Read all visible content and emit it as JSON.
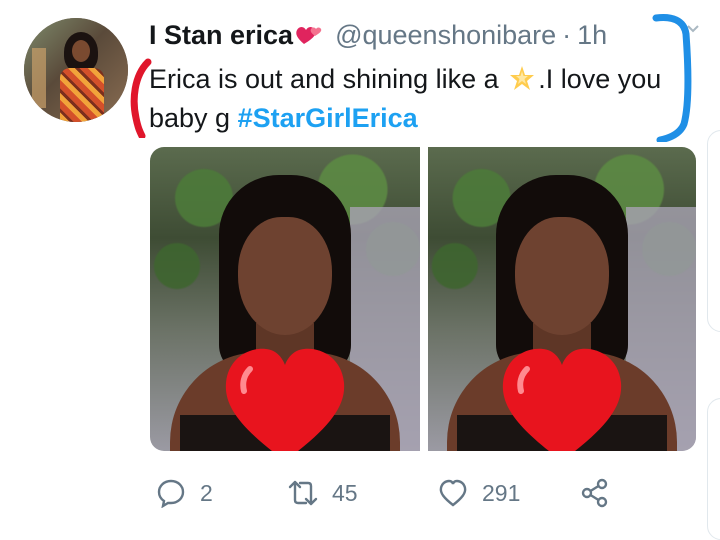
{
  "tweet": {
    "display_name": "I Stan erica",
    "handle": "@queenshonibare",
    "time": "1h",
    "text_part1": "Erica is out and shining like a ",
    "text_part2": ".I love you baby g ",
    "hashtag": "#StarGirlErica"
  },
  "icons": {
    "name_emoji": "two-hearts-icon",
    "text_emoji": "glowing-star-icon"
  },
  "actions": {
    "reply_count": "2",
    "retweet_count": "45",
    "like_count": "291"
  },
  "colors": {
    "link": "#1da1f2",
    "secondary_text": "#657786",
    "annotation_red": "#e0162b",
    "annotation_blue": "#1f8fe6",
    "heart_overlay": "#e8141e"
  }
}
